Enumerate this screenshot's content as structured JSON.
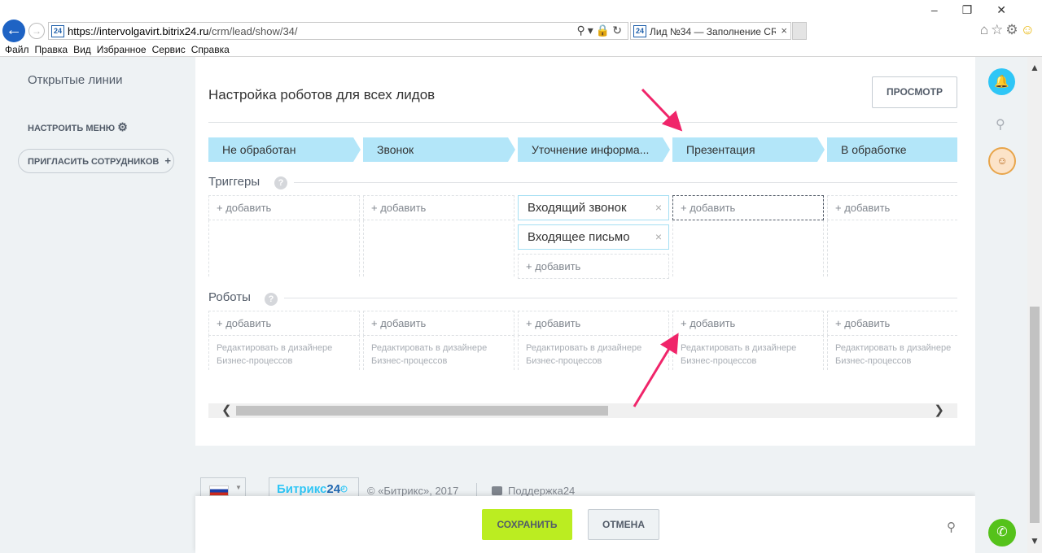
{
  "browser": {
    "favicon": "24",
    "url_host": "https://intervolgavirt.bitrix24.ru",
    "url_path": "/crm/lead/show/34/",
    "tab_title": "Лид №34 — Заполнение CR...",
    "menu": [
      "Файл",
      "Правка",
      "Вид",
      "Избранное",
      "Сервис",
      "Справка"
    ]
  },
  "sidebar": {
    "open_lines": "Открытые линии",
    "configure_menu": "НАСТРОИТЬ МЕНЮ",
    "invite": "ПРИГЛАСИТЬ СОТРУДНИКОВ"
  },
  "main": {
    "title": "Настройка роботов для всех лидов",
    "preview_button": "ПРОСМОТР",
    "stages": [
      "Не обработан",
      "Звонок",
      "Уточнение информа...",
      "Презентация",
      "В обработке"
    ],
    "triggers_title": "Триггеры",
    "robots_title": "Роботы",
    "add_label": "добавить",
    "triggers_stage3": [
      "Входящий звонок",
      "Входящее письмо"
    ],
    "bp_link_line1": "Редактировать в дизайнере",
    "bp_link_line2": "Бизнес-процессов"
  },
  "footer": {
    "logo_a": "Битрикс",
    "logo_b": "24",
    "copyright": "© «Битрикс», 2017",
    "support": "Поддержка24"
  },
  "actions": {
    "save": "СОХРАНИТЬ",
    "cancel": "ОТМЕНА"
  },
  "colors": {
    "stage": "#b3e6f9",
    "accent_green": "#bbed21",
    "bitrix_blue": "#2fc6f6",
    "annotation_arrow": "#f0256a"
  },
  "icons": [
    "back-icon",
    "forward-icon",
    "search-icon",
    "lock-icon",
    "refresh-icon",
    "home-icon",
    "star-icon",
    "gear-icon",
    "smiley-icon",
    "bell-icon",
    "phone-icon",
    "pin-icon",
    "help-icon",
    "close-icon",
    "plus-icon"
  ]
}
